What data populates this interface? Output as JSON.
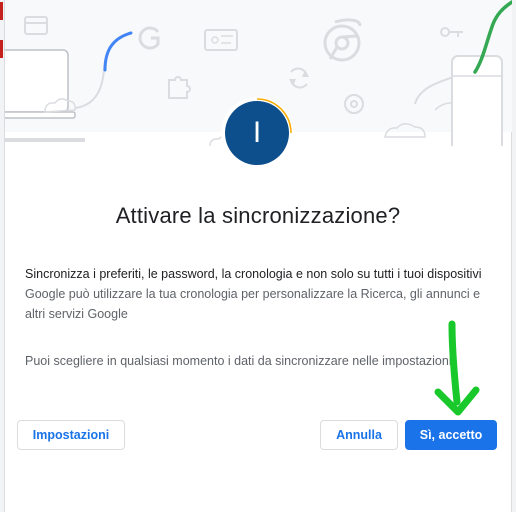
{
  "dialog": {
    "avatar_initial": "I",
    "title": "Attivare la sincronizzazione?",
    "description_strong": "Sincronizza i preferiti, le password, la cronologia e non solo su tutti i tuoi dispositivi",
    "description_secondary": "Google può utilizzare la tua cronologia per personalizzare la Ricerca, gli annunci e altri servizi Google",
    "settings_note": "Puoi scegliere in qualsiasi momento i dati da sincronizzare nelle impostazioni."
  },
  "buttons": {
    "settings_label": "Impostazioni",
    "cancel_label": "Annulla",
    "accept_label": "Sì, accetto"
  },
  "banner_icons": [
    "laptop-icon",
    "google-g-icon",
    "ticket-icon",
    "chrome-icon",
    "key-icon",
    "phone-icon",
    "puzzle-icon",
    "sync-icon",
    "gear-icon",
    "cloud-icon",
    "card-icon"
  ],
  "colors": {
    "primary": "#1a73e8",
    "avatar": "#0d4f8c",
    "annotation": "#19c92b",
    "banner_blue": "#4285f4",
    "banner_green": "#34a853",
    "banner_orange": "#f9ab00"
  }
}
